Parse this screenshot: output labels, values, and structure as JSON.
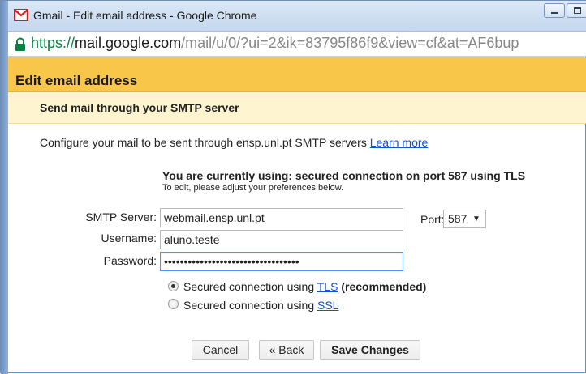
{
  "window": {
    "title": "Gmail - Edit email address - Google Chrome"
  },
  "address_bar": {
    "scheme": "https://",
    "host": "mail.google.com",
    "path": "/mail/u/0/?ui=2&ik=83795f86f9&view=cf&at=AF6bup"
  },
  "dialog": {
    "title": "Edit email address",
    "subtitle": "Send mail through your SMTP server",
    "config_text": "Configure your mail to be sent through ensp.unl.pt SMTP servers",
    "learn_more": "Learn more",
    "status": "You are currently using: secured connection on port 587 using TLS",
    "status_sub": "To edit, please adjust your preferences below."
  },
  "form": {
    "smtp_label": "SMTP Server:",
    "smtp_value": "webmail.ensp.unl.pt",
    "port_label": "Port:",
    "port_value": "587",
    "username_label": "Username:",
    "username_value": "aluno.teste",
    "password_label": "Password:",
    "password_value": "••••••••••••••••••••••••••••••••••"
  },
  "security": {
    "tls_prefix": "Secured connection using",
    "tls_link": "TLS",
    "tls_suffix": "(recommended)",
    "ssl_prefix": "Secured connection using",
    "ssl_link": "SSL",
    "selected": "TLS"
  },
  "buttons": {
    "cancel": "Cancel",
    "back": "« Back",
    "save": "Save Changes"
  },
  "colors": {
    "header": "#f8c648",
    "subheader": "#fef4cf",
    "link": "#1155cc",
    "url_scheme": "#0b8043",
    "focus_border": "#4d90fe"
  }
}
